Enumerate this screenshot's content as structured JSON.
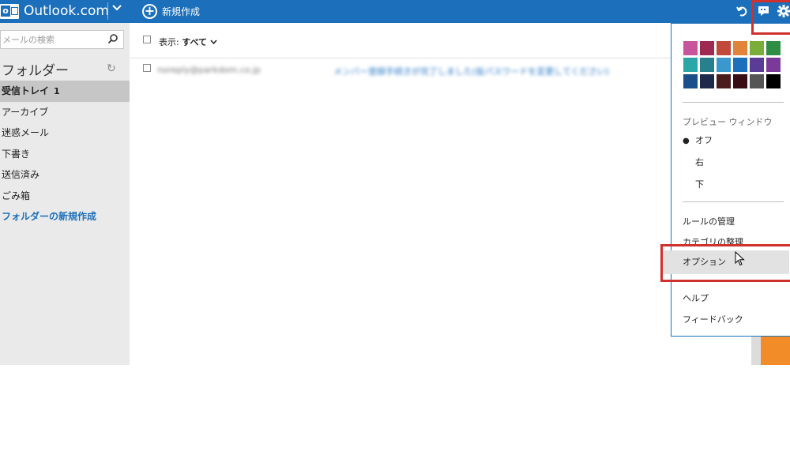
{
  "header": {
    "brand": "Outlook.com",
    "new_label": "新規作成",
    "icons": [
      "outlook-logo-icon",
      "chevron-down-icon",
      "plus-circle-icon",
      "undo-icon",
      "chat-icon",
      "gear-icon"
    ]
  },
  "sidebar": {
    "search_placeholder": "メールの検索",
    "folders_title": "フォルダー",
    "items": [
      {
        "label": "受信トレイ",
        "count": "1"
      },
      {
        "label": "アーカイブ"
      },
      {
        "label": "迷惑メール"
      },
      {
        "label": "下書き"
      },
      {
        "label": "送信済み"
      },
      {
        "label": "ごみ箱"
      },
      {
        "label": "フォルダーの新規作成"
      }
    ]
  },
  "main": {
    "filter_label": "表示:",
    "filter_value": "すべて",
    "messages": [
      {
        "sender": "noreply@parkdom.co.jp",
        "subject": "メンバー登録手続きが完了しました(仮パスワードを変更してください)"
      }
    ]
  },
  "settings_menu": {
    "theme_colors": [
      "#c8549b",
      "#9e2a52",
      "#c2483a",
      "#e0843a",
      "#7aae3a",
      "#2e8e43",
      "#2aa6a6",
      "#287f8e",
      "#3b98cf",
      "#1c6fba",
      "#5a3b96",
      "#7b3a9a",
      "#1b4f8a",
      "#1e2a4a",
      "#4a1c1c",
      "#3a0c14",
      "#555555",
      "#000000"
    ],
    "preview_title": "プレビュー ウィンドウ",
    "preview_options": [
      {
        "label": "オフ",
        "selected": true
      },
      {
        "label": "右",
        "selected": false
      },
      {
        "label": "下",
        "selected": false
      }
    ],
    "items": [
      "ルールの管理",
      "カテゴリの整理",
      "オプション",
      "ヘルプ",
      "フィードバック"
    ]
  }
}
